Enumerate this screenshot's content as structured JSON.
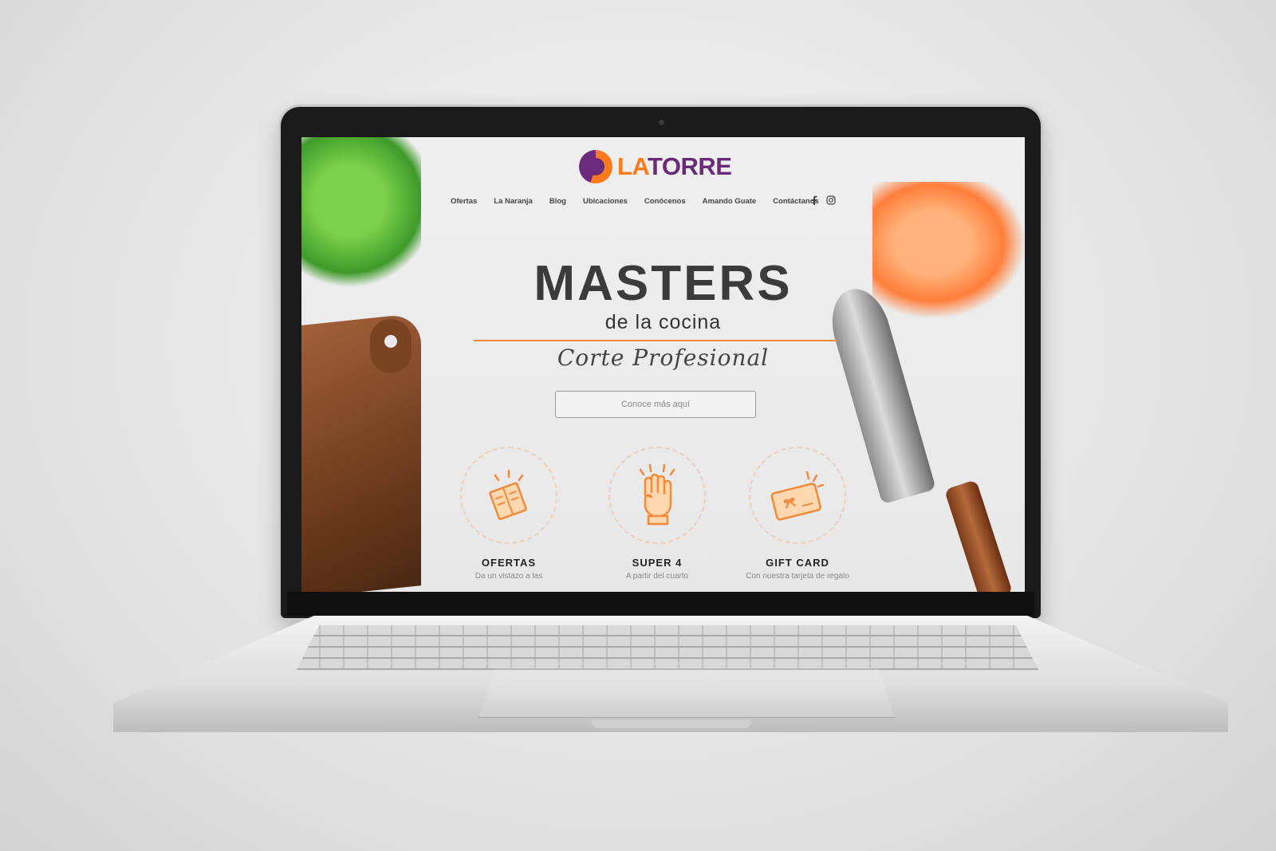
{
  "brand": {
    "la": "LA",
    "torre": "TORRE"
  },
  "nav": {
    "items": [
      "Ofertas",
      "La Naranja",
      "Blog",
      "Ubicaciones",
      "Conócenos",
      "Amando Guate",
      "Contáctanos"
    ],
    "social": [
      "facebook-icon",
      "instagram-icon"
    ]
  },
  "hero": {
    "title": "MASTERS",
    "subtitle": "de la cocina",
    "script": "Corte Profesional",
    "cta": "Conoce más aquí"
  },
  "features": [
    {
      "title": "OFERTAS",
      "desc": "Da un vistazo a las",
      "icon": "newspaper-icon"
    },
    {
      "title": "SUPER 4",
      "desc": "A partir del cuarto",
      "icon": "hand-four-icon"
    },
    {
      "title": "GIFT CARD",
      "desc": "Con nuestra tarjeta de regalo",
      "icon": "gift-card-icon"
    }
  ],
  "colors": {
    "orange": "#f28a3c",
    "purple": "#6b2a7a",
    "text": "#3b3b3b"
  }
}
